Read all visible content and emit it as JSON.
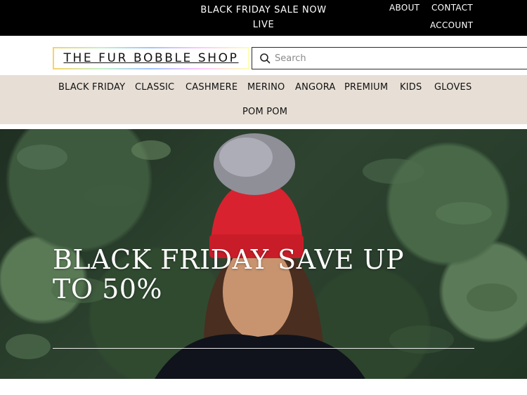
{
  "colors": {
    "topbar_bg": "#000000",
    "nav_bg": "#e7dfd6",
    "text_dark": "#111111",
    "hero_text": "#ffffff"
  },
  "topbar": {
    "announcement": "BLACK FRIDAY SALE NOW LIVE",
    "links": {
      "about": "ABOUT",
      "contact": "CONTACT",
      "account": "ACCOUNT"
    }
  },
  "header": {
    "logo_text": "THE FUR BOBBLE SHOP",
    "search": {
      "placeholder": "Search",
      "value": "",
      "icon": "search-icon"
    }
  },
  "nav": {
    "items": [
      {
        "label": "BLACK FRIDAY"
      },
      {
        "label": "CLASSIC"
      },
      {
        "label": "CASHMERE"
      },
      {
        "label": "MERINO"
      },
      {
        "label": "ANGORA"
      },
      {
        "label": "PREMIUM"
      },
      {
        "label": "KIDS"
      },
      {
        "label": "GLOVES"
      },
      {
        "label": "POM POM"
      }
    ]
  },
  "hero": {
    "headline": "BLACK FRIDAY SAVE UP TO 50%"
  }
}
